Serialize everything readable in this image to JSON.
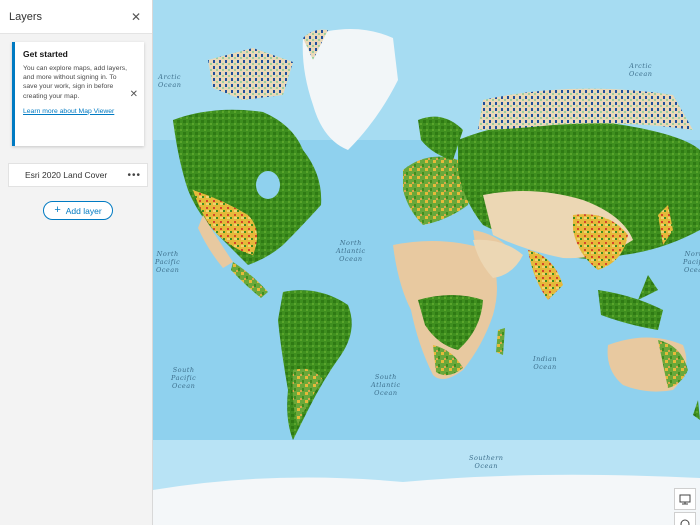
{
  "panel": {
    "title": "Layers",
    "close_icon": "close-icon"
  },
  "get_started": {
    "title": "Get started",
    "body": "You can explore maps, add layers, and more without signing in. To save your work, sign in before creating your map.",
    "link": "Learn more about Map Viewer",
    "dismiss_icon": "close-icon"
  },
  "layers": [
    {
      "name": "Esri 2020 Land Cover",
      "options_icon": "more-options-icon"
    }
  ],
  "add_layer": {
    "label": "Add layer",
    "icon": "plus-icon"
  },
  "map": {
    "labels": {
      "arctic_left": "Arctic\nOcean",
      "arctic_right": "Arctic\nOcean",
      "north_pacific_left": "North\nPacific\nOcean",
      "north_pacific_right": "North\nPacific\nOcean",
      "north_atlantic": "North\nAtlantic\nOcean",
      "south_pacific": "South\nPacific\nOcean",
      "south_atlantic": "South\nAtlantic\nOcean",
      "indian": "Indian\nOcean",
      "southern": "Southern\nOcean"
    },
    "controls": [
      {
        "icon": "monitor-icon"
      },
      {
        "icon": "sketch-icon"
      }
    ]
  },
  "colors": {
    "accent": "#007ac2",
    "water": "#8fd1ee",
    "forest": "#3f8f1f",
    "bare": "#e8c9a0",
    "crops": "#e6b93a",
    "snow": "#f2f6f8",
    "built": "#d4452a"
  }
}
